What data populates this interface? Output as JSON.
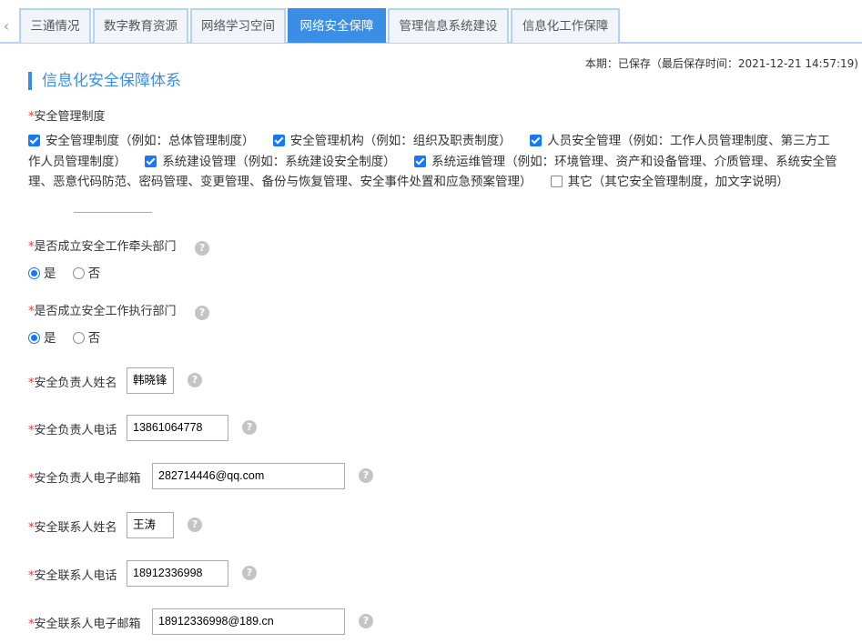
{
  "tabs": {
    "back_icon": "‹",
    "items": [
      {
        "label": "三通情况"
      },
      {
        "label": "数字教育资源"
      },
      {
        "label": "网络学习空间"
      },
      {
        "label": "网络安全保障",
        "active": true
      },
      {
        "label": "管理信息系统建设"
      },
      {
        "label": "信息化工作保障"
      }
    ]
  },
  "status": "本期：已保存（最后保存时间：2021-12-21 14:57:19)",
  "section_title": "信息化安全保障体系",
  "required_mark": "*",
  "help_glyph": "?",
  "mgmt": {
    "label": "安全管理制度",
    "options": [
      {
        "label": "安全管理制度（例如：总体管理制度）",
        "checked": true
      },
      {
        "label": "安全管理机构（例如：组织及职责制度）",
        "checked": true
      },
      {
        "label": "人员安全管理（例如：工作人员管理制度、第三方工作人员管理制度）",
        "checked": true
      },
      {
        "label": "系统建设管理（例如：系统建设安全制度）",
        "checked": true
      },
      {
        "label": "系统运维管理（例如：环境管理、资产和设备管理、介质管理、系统安全管理、恶意代码防范、密码管理、变更管理、备份与恢复管理、安全事件处置和应急预案管理）",
        "checked": true
      },
      {
        "label": "其它（其它安全管理制度，加文字说明）",
        "checked": false
      }
    ]
  },
  "q1": {
    "label": "是否成立安全工作牵头部门",
    "yes": "是",
    "no": "否",
    "value": "是"
  },
  "q2": {
    "label": "是否成立安全工作执行部门",
    "yes": "是",
    "no": "否",
    "value": "是"
  },
  "fields": [
    {
      "label": "安全负责人姓名",
      "value": "韩晓锋"
    },
    {
      "label": "安全负责人电话",
      "value": "13861064778"
    },
    {
      "label": "安全负责人电子邮箱",
      "value": "282714446@qq.com"
    },
    {
      "label": "安全联系人姓名",
      "value": "王涛"
    },
    {
      "label": "安全联系人电话",
      "value": "18912336998"
    },
    {
      "label": "安全联系人电子邮箱",
      "value": "18912336998@189.cn"
    }
  ],
  "colors": {
    "accent": "#3a8ee6",
    "checkbox": "#1677ff",
    "required": "#e33333"
  }
}
